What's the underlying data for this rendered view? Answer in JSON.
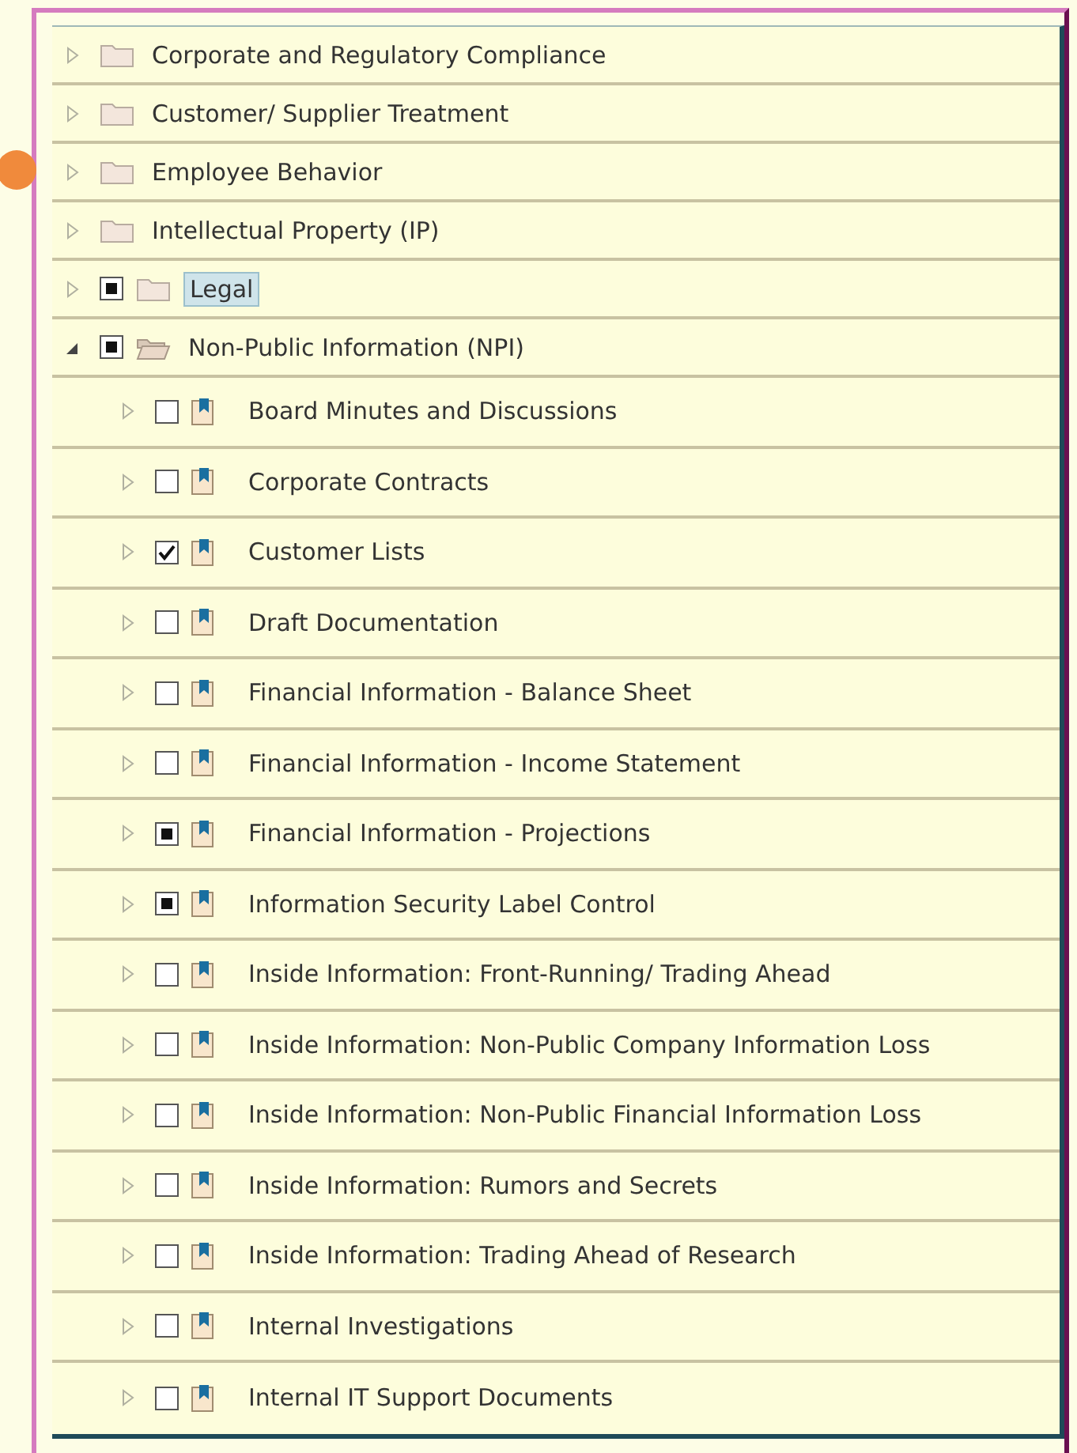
{
  "tree": {
    "items": [
      {
        "label": "Corporate and Regulatory Compliance",
        "kind": "folder",
        "expanded": false,
        "selected": false
      },
      {
        "label": "Customer/ Supplier Treatment",
        "kind": "folder",
        "expanded": false,
        "selected": false
      },
      {
        "label": "Employee Behavior",
        "kind": "folder",
        "expanded": false,
        "selected": false
      },
      {
        "label": "Intellectual Property (IP)",
        "kind": "folder",
        "expanded": false,
        "selected": false
      },
      {
        "label": "Legal",
        "kind": "folder",
        "expanded": false,
        "selected": true,
        "checked": false,
        "partial": true
      },
      {
        "label": "Non-Public Information (NPI)",
        "kind": "folder",
        "expanded": true,
        "selected": false,
        "checked": false,
        "partial": true,
        "children": [
          {
            "label": "Board Minutes and Discussions",
            "kind": "document",
            "expanded": false,
            "selected": false,
            "checked": false,
            "partial": false
          },
          {
            "label": "Corporate Contracts",
            "kind": "document",
            "expanded": false,
            "selected": false,
            "checked": false,
            "partial": false
          },
          {
            "label": "Customer Lists",
            "kind": "document",
            "expanded": false,
            "selected": false,
            "checked": true,
            "partial": false
          },
          {
            "label": "Draft Documentation",
            "kind": "document",
            "expanded": false,
            "selected": false,
            "checked": false,
            "partial": false
          },
          {
            "label": "Financial Information - Balance Sheet",
            "kind": "document",
            "expanded": false,
            "selected": false,
            "checked": false,
            "partial": false
          },
          {
            "label": "Financial Information - Income Statement",
            "kind": "document",
            "expanded": false,
            "selected": false,
            "checked": false,
            "partial": false
          },
          {
            "label": "Financial Information - Projections",
            "kind": "document",
            "expanded": false,
            "selected": false,
            "checked": false,
            "partial": true
          },
          {
            "label": "Information Security Label Control",
            "kind": "document",
            "expanded": false,
            "selected": false,
            "checked": false,
            "partial": true
          },
          {
            "label": "Inside Information: Front-Running/ Trading Ahead",
            "kind": "document",
            "expanded": false,
            "selected": false,
            "checked": false,
            "partial": false
          },
          {
            "label": "Inside Information: Non-Public Company Information Loss",
            "kind": "document",
            "expanded": false,
            "selected": false,
            "checked": false,
            "partial": false
          },
          {
            "label": "Inside Information: Non-Public Financial Information Loss",
            "kind": "document",
            "expanded": false,
            "selected": false,
            "checked": false,
            "partial": false
          },
          {
            "label": "Inside Information: Rumors and Secrets",
            "kind": "document",
            "expanded": false,
            "selected": false,
            "checked": false,
            "partial": false
          },
          {
            "label": "Inside Information: Trading Ahead of Research",
            "kind": "document",
            "expanded": false,
            "selected": false,
            "checked": false,
            "partial": false
          },
          {
            "label": "Internal Investigations",
            "kind": "document",
            "expanded": false,
            "selected": false,
            "checked": false,
            "partial": false
          },
          {
            "label": "Internal IT Support Documents",
            "kind": "document",
            "expanded": false,
            "selected": false,
            "checked": false,
            "partial": false
          }
        ]
      }
    ]
  }
}
